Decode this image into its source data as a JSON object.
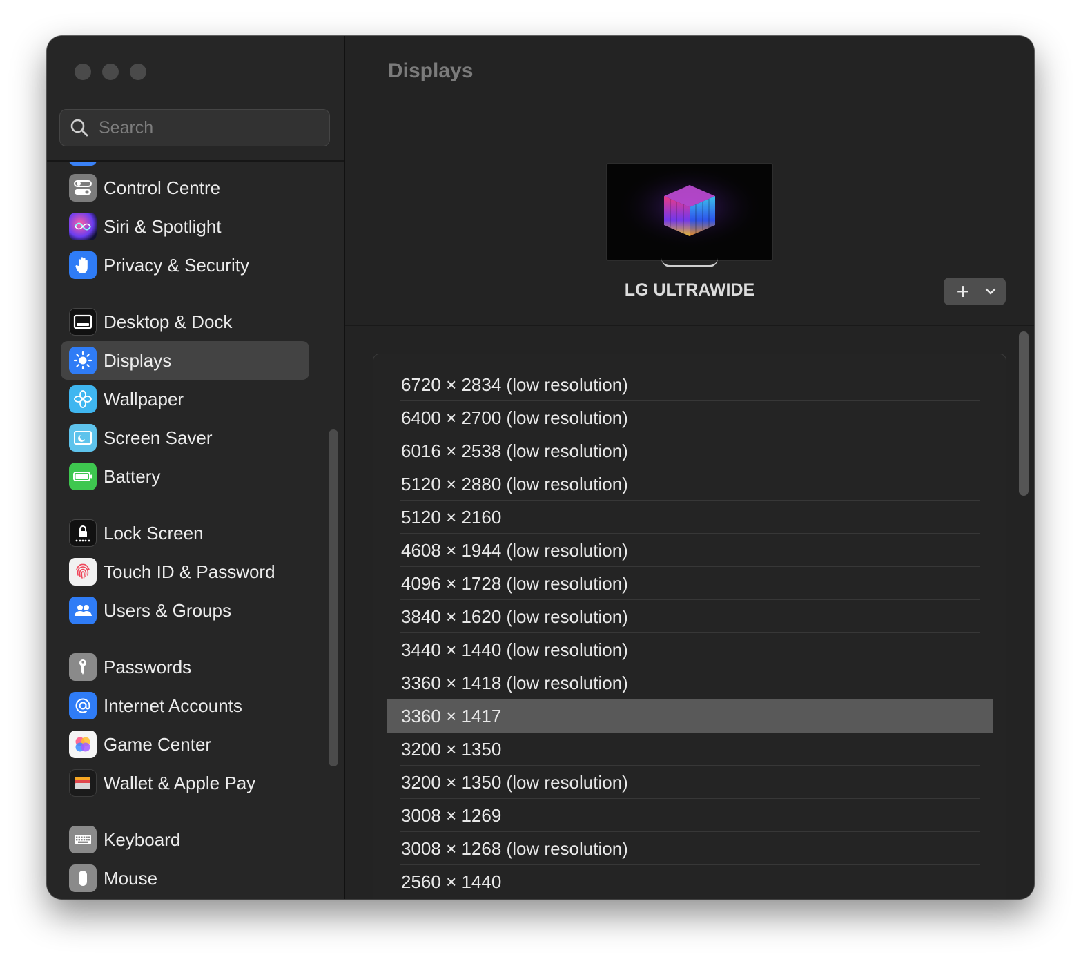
{
  "search": {
    "placeholder": "Search"
  },
  "sidebar": {
    "items": [
      {
        "label": "Control Centre",
        "icon": "control-centre-icon"
      },
      {
        "label": "Siri & Spotlight",
        "icon": "siri-icon"
      },
      {
        "label": "Privacy & Security",
        "icon": "hand-icon"
      },
      {
        "label": "Desktop & Dock",
        "icon": "dock-icon"
      },
      {
        "label": "Displays",
        "icon": "sun-icon"
      },
      {
        "label": "Wallpaper",
        "icon": "flower-icon"
      },
      {
        "label": "Screen Saver",
        "icon": "screen-saver-icon"
      },
      {
        "label": "Battery",
        "icon": "battery-icon"
      },
      {
        "label": "Lock Screen",
        "icon": "lock-icon"
      },
      {
        "label": "Touch ID & Password",
        "icon": "fingerprint-icon"
      },
      {
        "label": "Users & Groups",
        "icon": "users-icon"
      },
      {
        "label": "Passwords",
        "icon": "key-icon"
      },
      {
        "label": "Internet Accounts",
        "icon": "at-icon"
      },
      {
        "label": "Game Center",
        "icon": "game-center-icon"
      },
      {
        "label": "Wallet & Apple Pay",
        "icon": "wallet-icon"
      },
      {
        "label": "Keyboard",
        "icon": "keyboard-icon"
      },
      {
        "label": "Mouse",
        "icon": "mouse-icon"
      }
    ],
    "selected": "Displays"
  },
  "main": {
    "title": "Displays",
    "display_name": "LG ULTRAWIDE",
    "add_button": "+",
    "resolutions": [
      "6720 × 2834 (low resolution)",
      "6400 × 2700 (low resolution)",
      "6016 × 2538 (low resolution)",
      "5120 × 2880 (low resolution)",
      "5120 × 2160",
      "4608 × 1944 (low resolution)",
      "4096 × 1728 (low resolution)",
      "3840 × 1620 (low resolution)",
      "3440 × 1440 (low resolution)",
      "3360 × 1418 (low resolution)",
      "3360 × 1417",
      "3200 × 1350",
      "3200 × 1350 (low resolution)",
      "3008 × 1269",
      "3008 × 1268 (low resolution)",
      "2560 × 1440"
    ],
    "selected_resolution": "3360 × 1417"
  },
  "colors": {
    "window_bg": "#1e1e1e",
    "sidebar_bg": "#262626",
    "selected_item": "#434343",
    "selected_row": "#595959",
    "accent_blue": "#3a82f7"
  }
}
